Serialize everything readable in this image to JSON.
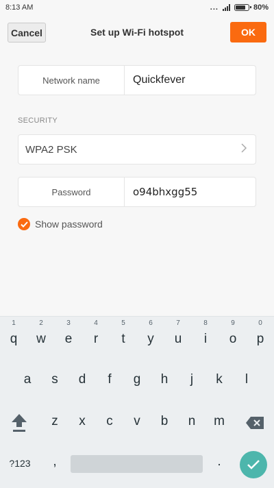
{
  "status_bar": {
    "time": "8:13 AM",
    "dots": "...",
    "battery_percent": "80%",
    "battery_level": 0.8,
    "signal_icon": "signal-icon",
    "battery_icon": "battery-icon"
  },
  "action_bar": {
    "cancel_label": "Cancel",
    "title": "Set up Wi-Fi hotspot",
    "ok_label": "OK"
  },
  "form": {
    "network_name_label": "Network name",
    "network_name_value": "Quickfever",
    "security_section_label": "SECURITY",
    "security_value": "WPA2 PSK",
    "password_label": "Password",
    "password_value": "o94bhxgg55",
    "show_password_label": "Show password",
    "show_password_checked": true
  },
  "keyboard": {
    "row1": [
      {
        "key": "q",
        "hint": "1"
      },
      {
        "key": "w",
        "hint": "2"
      },
      {
        "key": "e",
        "hint": "3"
      },
      {
        "key": "r",
        "hint": "4"
      },
      {
        "key": "t",
        "hint": "5"
      },
      {
        "key": "y",
        "hint": "6"
      },
      {
        "key": "u",
        "hint": "7"
      },
      {
        "key": "i",
        "hint": "8"
      },
      {
        "key": "o",
        "hint": "9"
      },
      {
        "key": "p",
        "hint": "0"
      }
    ],
    "row2": [
      "a",
      "s",
      "d",
      "f",
      "g",
      "h",
      "j",
      "k",
      "l"
    ],
    "row3": [
      "z",
      "x",
      "c",
      "v",
      "b",
      "n",
      "m"
    ],
    "symbols_label": "?123",
    "comma": ",",
    "period": ".",
    "accent_color": "#4db6ac"
  },
  "colors": {
    "accent": "#fa6a10",
    "background": "#f7f7f7"
  }
}
